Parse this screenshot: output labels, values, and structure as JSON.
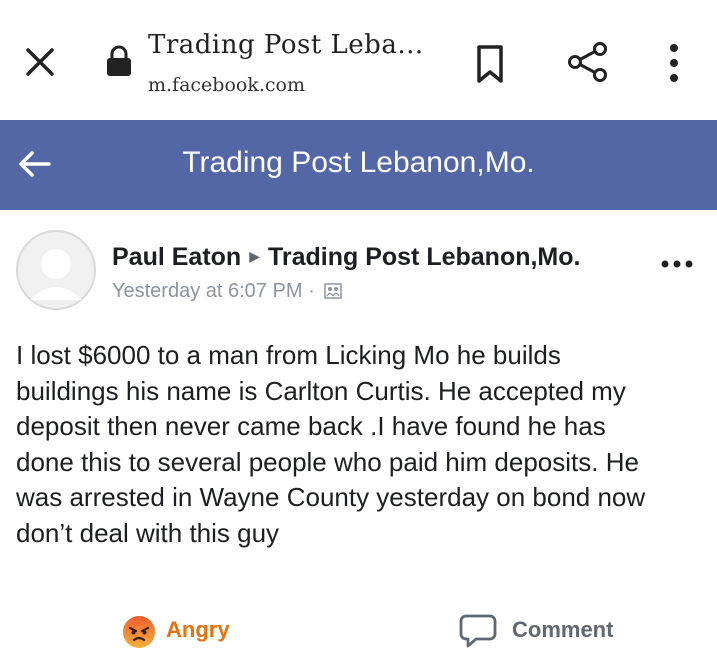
{
  "browser": {
    "page_title": "Trading Post Leba...",
    "domain": "m.facebook.com"
  },
  "header": {
    "title": "Trading Post Lebanon,Mo.",
    "color": "#5366a5"
  },
  "post": {
    "author": "Paul Eaton",
    "group": "Trading Post Lebanon,Mo.",
    "timestamp": "Yesterday at 6:07 PM",
    "separator": "·",
    "body_lines": [
      "I lost $6000 to a man from Licking Mo he builds",
      "buildings his name is Carlton Curtis. He accepted my",
      "deposit then never came back .I have found he has",
      "done this to several people who paid him deposits. He",
      "was arrested in Wayne County yesterday on bond now",
      "don’t deal with this guy"
    ]
  },
  "actions": {
    "reaction_label": "Angry",
    "reaction_color": "#e9710f",
    "comment_label": "Comment"
  },
  "icons": [
    "close-icon",
    "lock-icon",
    "bookmark-icon",
    "share-icon",
    "more-icon",
    "back-arrow-icon",
    "avatar",
    "audience-icon",
    "post-options-icon",
    "angry-icon",
    "comment-icon"
  ]
}
